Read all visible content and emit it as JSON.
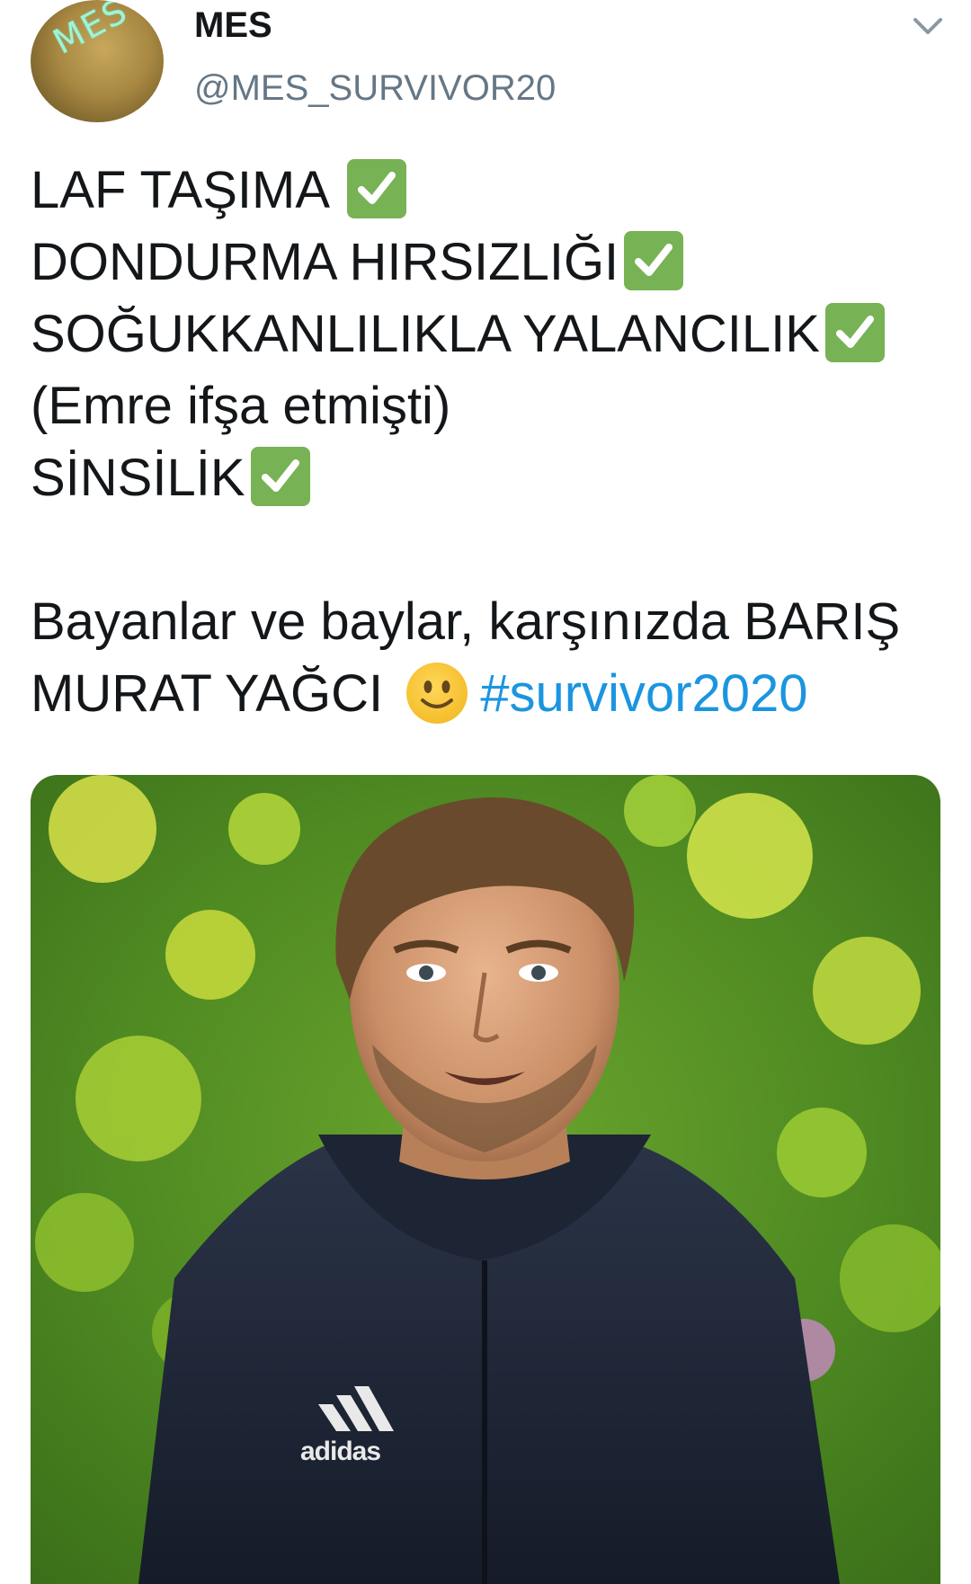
{
  "author": {
    "display_name": "MES",
    "handle": "@MES_SURVIVOR20",
    "avatar_text": "MES"
  },
  "tweet": {
    "lines": [
      "LAF TAŞIMA ",
      "DONDURMA HIRSIZLIĞI",
      "SOĞUKKANLILIKLA YALANCILIK",
      "(Emre ifşa etmişti)",
      "SİNSİLİK",
      "Bayanlar ve baylar, karşınızda BARIŞ",
      "MURAT YAĞCI "
    ],
    "hashtag": "#survivor2020",
    "emoji": [
      "check-mark-button",
      "slightly-smiling-face"
    ]
  },
  "media": {
    "shirt_logo_text": "adidas"
  },
  "colors": {
    "text": "#14171a",
    "secondary": "#657786",
    "link": "#1b95e0",
    "check": "#77b255"
  }
}
